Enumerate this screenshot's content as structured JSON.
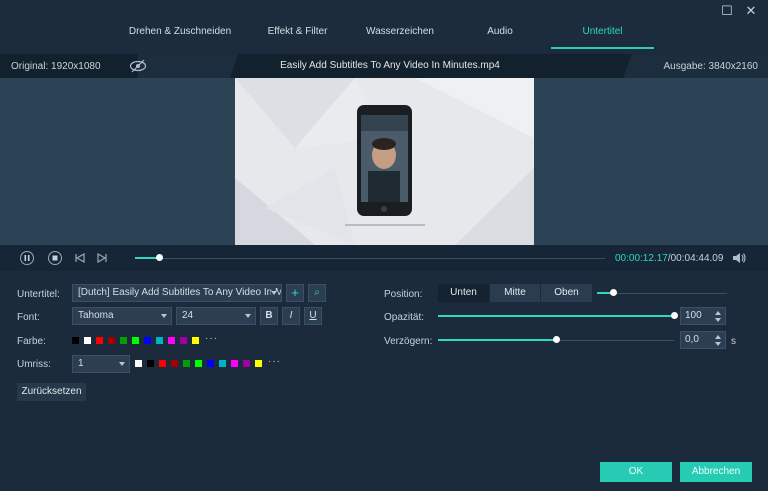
{
  "tabs": [
    {
      "label": "Drehen & Zuschneiden"
    },
    {
      "label": "Effekt & Filter"
    },
    {
      "label": "Wasserzeichen"
    },
    {
      "label": "Audio"
    },
    {
      "label": "Untertitel"
    }
  ],
  "active_tab": "Untertitel",
  "window": {
    "maximize": "☐",
    "close": "✕"
  },
  "infobar": {
    "original": "Original: 1920x1080",
    "filename": "Easily Add Subtitles To Any Video In Minutes.mp4",
    "output": "Ausgabe: 3840x2160"
  },
  "playback": {
    "current_time": "00:00:12.17",
    "total_time": "/00:04:44.09",
    "progress_fraction": 0.05
  },
  "subtitle": {
    "label": "Untertitel:",
    "value": "[Dutch] Easily Add Subtitles To Any Video In Minutes",
    "add_symbol": "+",
    "search_symbol": "⌕"
  },
  "font": {
    "label": "Font:",
    "family": "Tahoma",
    "size": "24",
    "bold": "B",
    "italic": "I",
    "underline": "U"
  },
  "color": {
    "label": "Farbe:",
    "swatches": [
      "#000000",
      "#ffffff",
      "#ff0000",
      "#a30000",
      "#00a000",
      "#00ff00",
      "#0000ff",
      "#00b4c8",
      "#ff00ff",
      "#a000a0",
      "#ffff00"
    ],
    "more": "···"
  },
  "outline": {
    "label": "Umriss:",
    "value": "1",
    "swatches": [
      "#ffffff",
      "#000000",
      "#ff0000",
      "#a30000",
      "#00a000",
      "#00ff00",
      "#0000ff",
      "#00b4c8",
      "#ff00ff",
      "#a000a0",
      "#ffff00"
    ],
    "more": "···"
  },
  "reset_label": "Zurücksetzen",
  "position": {
    "label": "Position:",
    "options": [
      "Unten",
      "Mitte",
      "Oben"
    ],
    "selected": "Unten"
  },
  "opacity": {
    "label": "Opazität:",
    "value": "100",
    "fraction": 1.0
  },
  "delay": {
    "label": "Verzögern:",
    "value": "0,0",
    "unit": "s",
    "fraction": 0.5
  },
  "ok_label": "OK",
  "cancel_label": "Abbrechen"
}
